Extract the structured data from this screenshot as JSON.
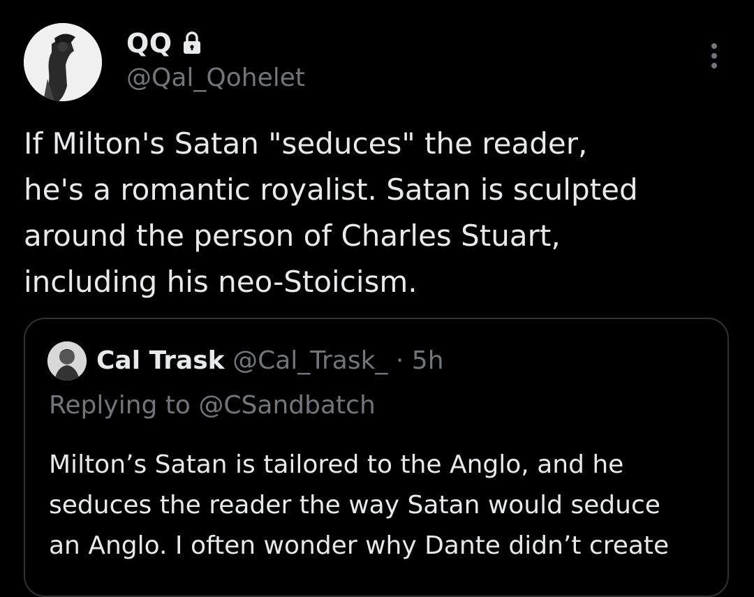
{
  "tweet": {
    "author": {
      "display_name": "QQ",
      "handle": "@Qal_Qohelet",
      "avatar_icon": "profile-avatar-icon",
      "protected_icon": "lock-icon"
    },
    "more_icon": "more-vertical-icon",
    "text": "If Milton's Satan \"seduces\" the reader,\nhe's a romantic royalist. Satan is sculpted\naround the person of Charles Stuart,\nincluding his neo-Stoicism.",
    "quoted": {
      "display_name": "Cal Trask",
      "handle": "@Cal_Trask_",
      "separator": "·",
      "time": "5h",
      "replying_to": "Replying to @CSandbatch",
      "text": "Milton’s Satan is tailored to the Anglo, and he\nseduces the reader the way Satan would seduce\nan Anglo. I often wonder why Dante didn’t create"
    }
  },
  "colors": {
    "background": "#000000",
    "primary_text": "#e7e9ea",
    "secondary_text": "#71767b",
    "border": "#2f3336"
  }
}
